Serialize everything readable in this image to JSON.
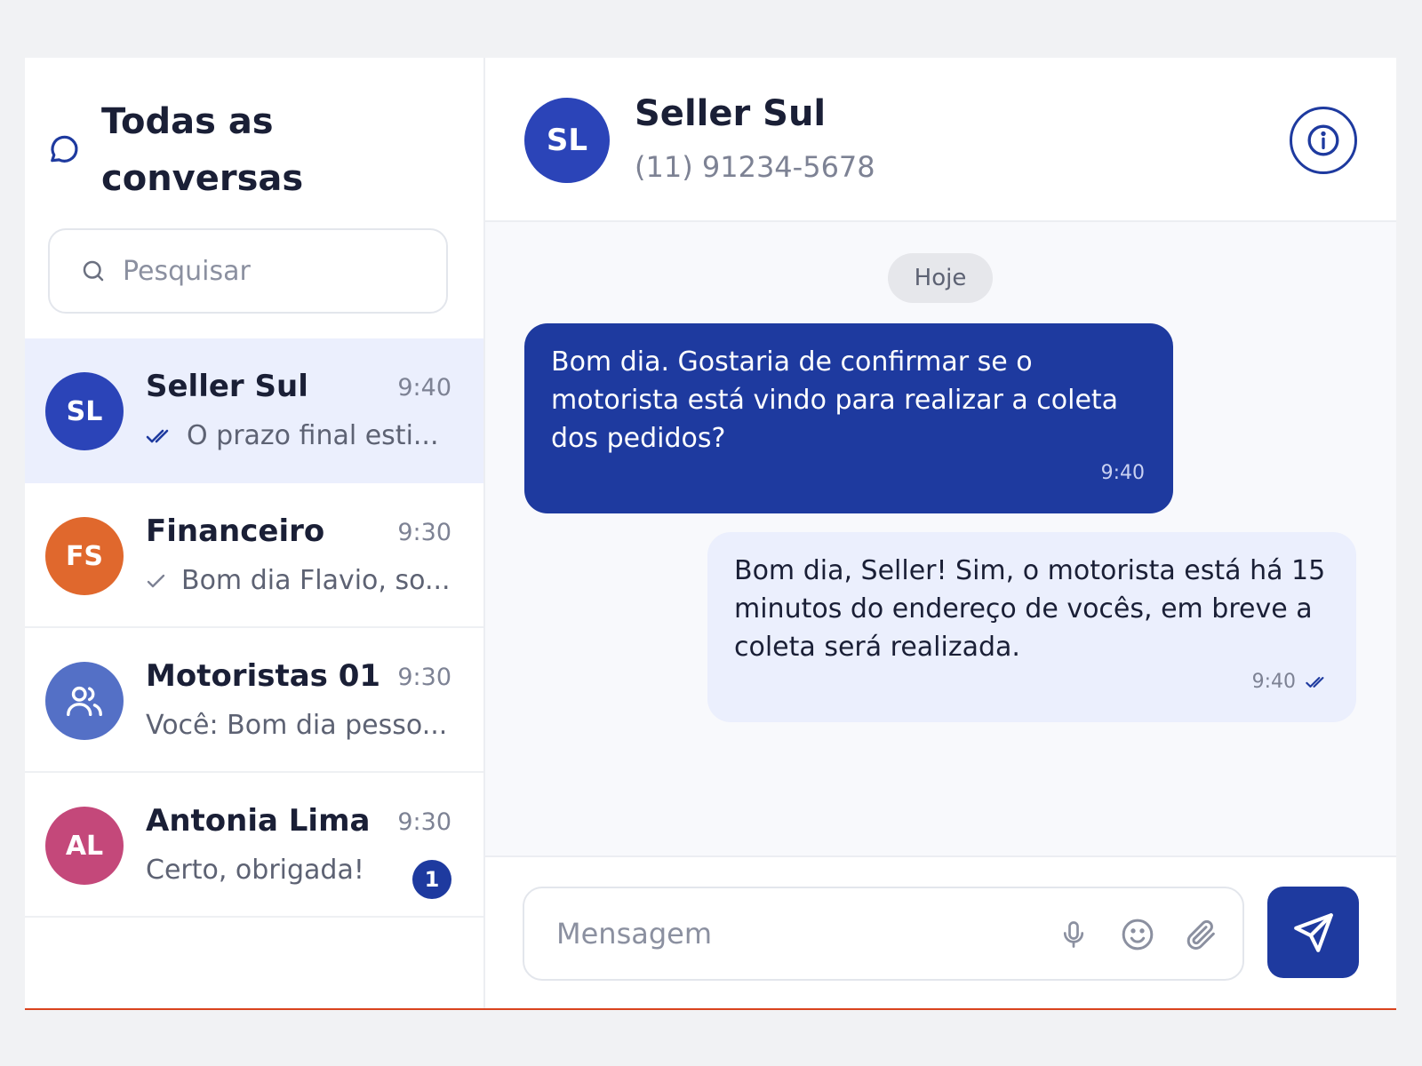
{
  "sidebar": {
    "title": "Todas as conversas",
    "search_placeholder": "Pesquisar",
    "conversations": [
      {
        "initials": "SL",
        "name": "Seller Sul",
        "time": "9:40",
        "preview": "O prazo final esti...",
        "avatar_color": "#2b44b8",
        "status": "read"
      },
      {
        "initials": "FS",
        "name": "Financeiro",
        "time": "9:30",
        "preview": "Bom dia Flavio, so...",
        "avatar_color": "#e0682d",
        "status": "sent"
      },
      {
        "initials": "",
        "name": "Motoristas 01",
        "time": "9:30",
        "preview": "Você: Bom dia pesso...",
        "avatar_color": "#5470c6",
        "icon": "group-icon"
      },
      {
        "initials": "AL",
        "name": "Antonia Lima",
        "time": "9:30",
        "preview": "Certo, obrigada!",
        "avatar_color": "#c4487a",
        "unread": "1"
      }
    ]
  },
  "chat": {
    "initials": "SL",
    "name": "Seller Sul",
    "phone": "(11) 91234-5678",
    "day_label": "Hoje",
    "messages": [
      {
        "direction": "incoming",
        "text": "Bom dia. Gostaria de confirmar se o motorista está vindo para realizar a coleta dos pedidos?",
        "time": "9:40"
      },
      {
        "direction": "outgoing",
        "text": "Bom dia, Seller! Sim, o motorista está há 15 minutos do endereço de vocês, em breve a coleta será realizada.",
        "time": "9:40",
        "status": "read"
      }
    ],
    "composer_placeholder": "Mensagem"
  },
  "colors": {
    "primary": "#1e3a9f",
    "active_row": "#ebeffd",
    "accent_line": "#d9431e"
  }
}
